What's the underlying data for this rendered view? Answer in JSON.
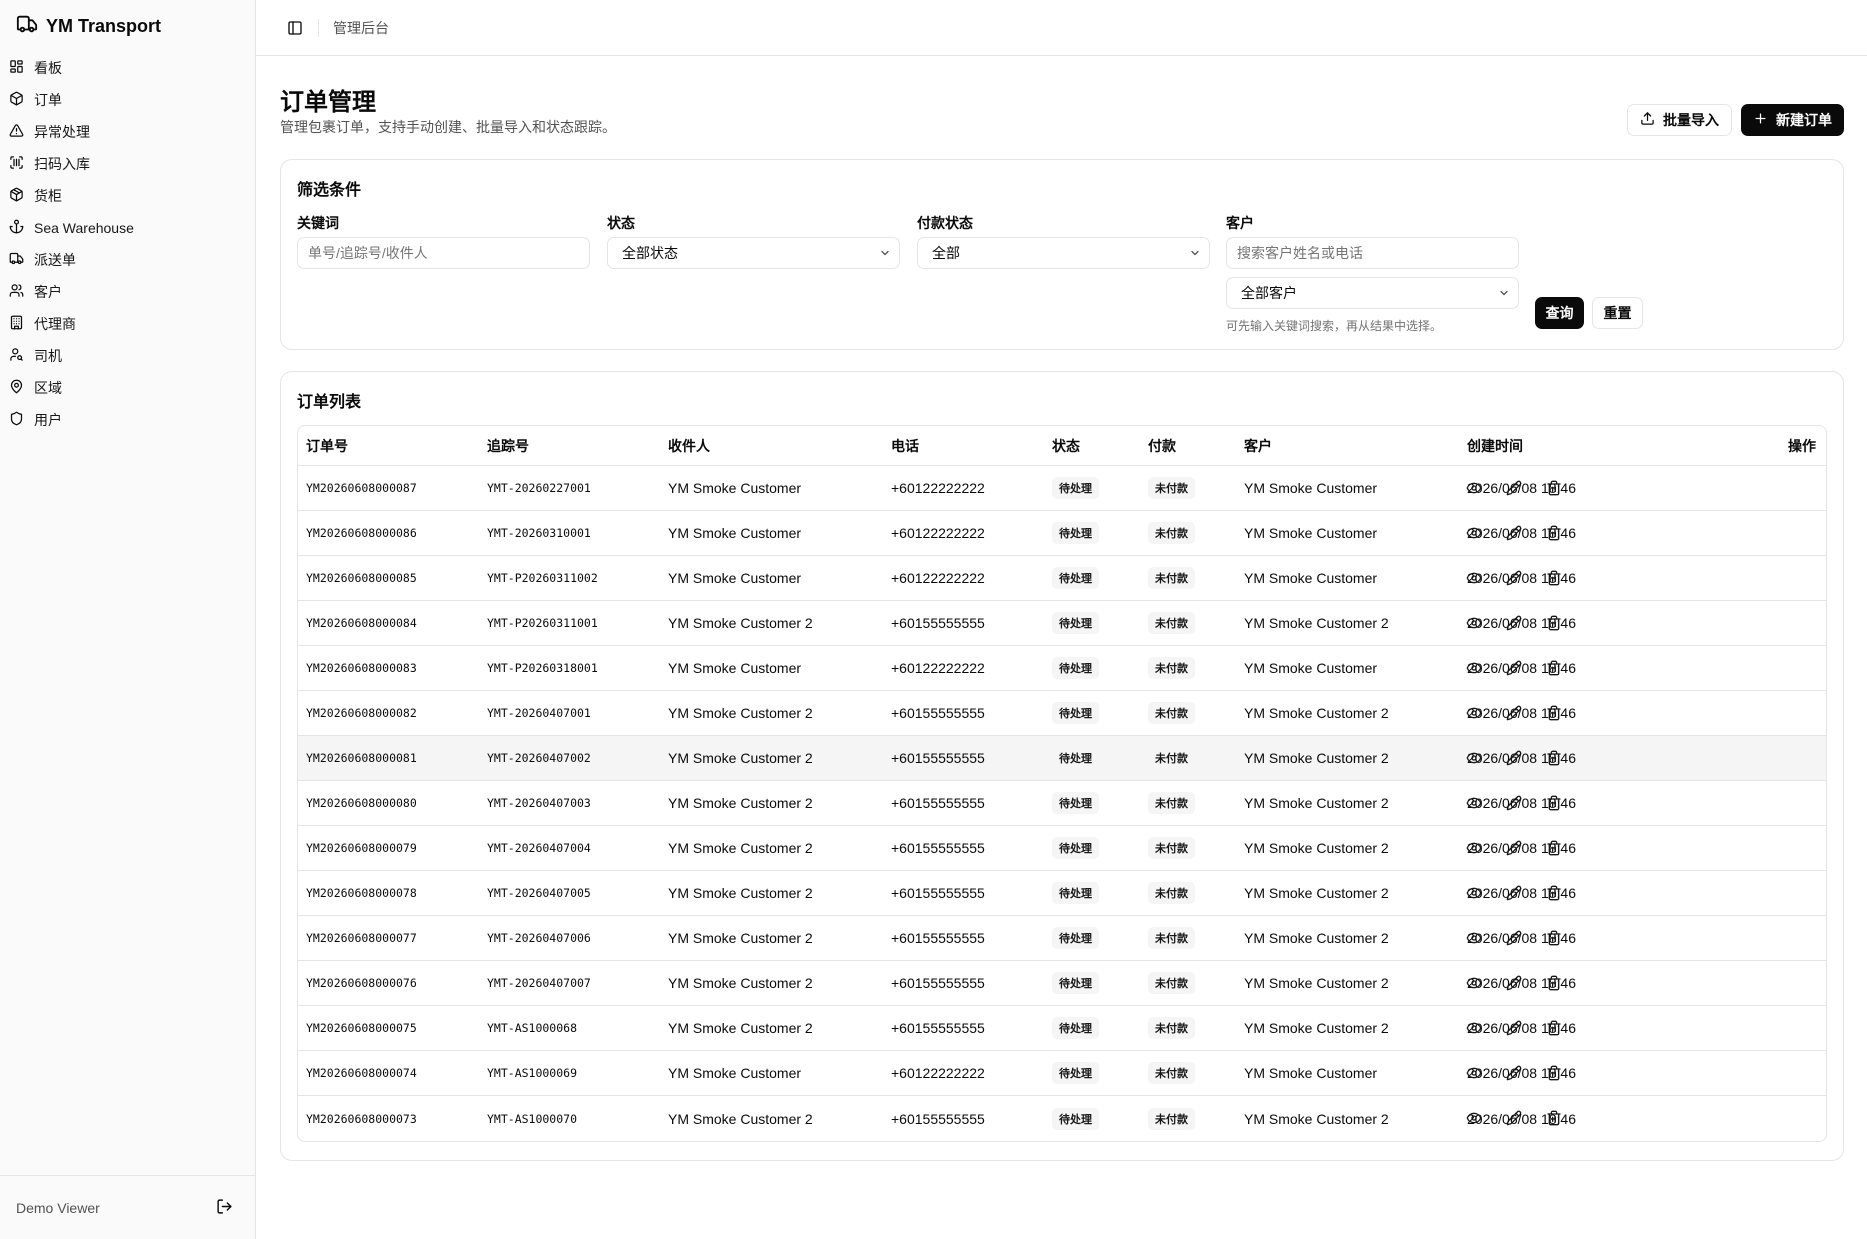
{
  "app": {
    "name": "YM Transport"
  },
  "sidebar": {
    "items": [
      {
        "label": "看板",
        "icon": "dashboard-icon"
      },
      {
        "label": "订单",
        "icon": "package-icon"
      },
      {
        "label": "异常处理",
        "icon": "alert-triangle-icon"
      },
      {
        "label": "扫码入库",
        "icon": "scan-icon"
      },
      {
        "label": "货柜",
        "icon": "container-icon"
      },
      {
        "label": "Sea Warehouse",
        "icon": "anchor-icon"
      },
      {
        "label": "派送单",
        "icon": "truck-icon"
      },
      {
        "label": "客户",
        "icon": "users-icon"
      },
      {
        "label": "代理商",
        "icon": "building-icon"
      },
      {
        "label": "司机",
        "icon": "driver-icon"
      },
      {
        "label": "区域",
        "icon": "map-pin-icon"
      },
      {
        "label": "用户",
        "icon": "shield-icon"
      }
    ],
    "footer_user": "Demo Viewer"
  },
  "topbar": {
    "breadcrumb": "管理后台"
  },
  "page": {
    "title": "订单管理",
    "subtitle": "管理包裹订单，支持手动创建、批量导入和状态跟踪。",
    "import_label": "批量导入",
    "new_label": "新建订单"
  },
  "filters": {
    "title": "筛选条件",
    "keyword_label": "关键词",
    "keyword_placeholder": "单号/追踪号/收件人",
    "status_label": "状态",
    "status_value": "全部状态",
    "payment_label": "付款状态",
    "payment_value": "全部",
    "customer_label": "客户",
    "customer_search_placeholder": "搜索客户姓名或电话",
    "customer_value": "全部客户",
    "customer_hint": "可先输入关键词搜索，再从结果中选择。",
    "query_label": "查询",
    "reset_label": "重置"
  },
  "orders": {
    "title": "订单列表",
    "columns": [
      "订单号",
      "追踪号",
      "收件人",
      "电话",
      "状态",
      "付款",
      "客户",
      "创建时间",
      "操作"
    ],
    "rows": [
      [
        "YM20260608000087",
        "YMT-20260227001",
        "YM Smoke Customer",
        "+60122222222",
        "待处理",
        "未付款",
        "YM Smoke Customer",
        "2026/06/08 18:46"
      ],
      [
        "YM20260608000086",
        "YMT-20260310001",
        "YM Smoke Customer",
        "+60122222222",
        "待处理",
        "未付款",
        "YM Smoke Customer",
        "2026/06/08 18:46"
      ],
      [
        "YM20260608000085",
        "YMT-P20260311002",
        "YM Smoke Customer",
        "+60122222222",
        "待处理",
        "未付款",
        "YM Smoke Customer",
        "2026/06/08 18:46"
      ],
      [
        "YM20260608000084",
        "YMT-P20260311001",
        "YM Smoke Customer 2",
        "+60155555555",
        "待处理",
        "未付款",
        "YM Smoke Customer 2",
        "2026/06/08 18:46"
      ],
      [
        "YM20260608000083",
        "YMT-P20260318001",
        "YM Smoke Customer",
        "+60122222222",
        "待处理",
        "未付款",
        "YM Smoke Customer",
        "2026/06/08 18:46"
      ],
      [
        "YM20260608000082",
        "YMT-20260407001",
        "YM Smoke Customer 2",
        "+60155555555",
        "待处理",
        "未付款",
        "YM Smoke Customer 2",
        "2026/06/08 18:46"
      ],
      [
        "YM20260608000081",
        "YMT-20260407002",
        "YM Smoke Customer 2",
        "+60155555555",
        "待处理",
        "未付款",
        "YM Smoke Customer 2",
        "2026/06/08 18:46"
      ],
      [
        "YM20260608000080",
        "YMT-20260407003",
        "YM Smoke Customer 2",
        "+60155555555",
        "待处理",
        "未付款",
        "YM Smoke Customer 2",
        "2026/06/08 18:46"
      ],
      [
        "YM20260608000079",
        "YMT-20260407004",
        "YM Smoke Customer 2",
        "+60155555555",
        "待处理",
        "未付款",
        "YM Smoke Customer 2",
        "2026/06/08 18:46"
      ],
      [
        "YM20260608000078",
        "YMT-20260407005",
        "YM Smoke Customer 2",
        "+60155555555",
        "待处理",
        "未付款",
        "YM Smoke Customer 2",
        "2026/06/08 18:46"
      ],
      [
        "YM20260608000077",
        "YMT-20260407006",
        "YM Smoke Customer 2",
        "+60155555555",
        "待处理",
        "未付款",
        "YM Smoke Customer 2",
        "2026/06/08 18:46"
      ],
      [
        "YM20260608000076",
        "YMT-20260407007",
        "YM Smoke Customer 2",
        "+60155555555",
        "待处理",
        "未付款",
        "YM Smoke Customer 2",
        "2026/06/08 18:46"
      ],
      [
        "YM20260608000075",
        "YMT-AS1000068",
        "YM Smoke Customer 2",
        "+60155555555",
        "待处理",
        "未付款",
        "YM Smoke Customer 2",
        "2026/06/08 18:46"
      ],
      [
        "YM20260608000074",
        "YMT-AS1000069",
        "YM Smoke Customer",
        "+60122222222",
        "待处理",
        "未付款",
        "YM Smoke Customer",
        "2026/06/08 18:46"
      ],
      [
        "YM20260608000073",
        "YMT-AS1000070",
        "YM Smoke Customer 2",
        "+60155555555",
        "待处理",
        "未付款",
        "YM Smoke Customer 2",
        "2026/06/08 18:46"
      ]
    ]
  },
  "row_action_icons": [
    "eye-icon",
    "edit-icon",
    "trash-icon"
  ]
}
